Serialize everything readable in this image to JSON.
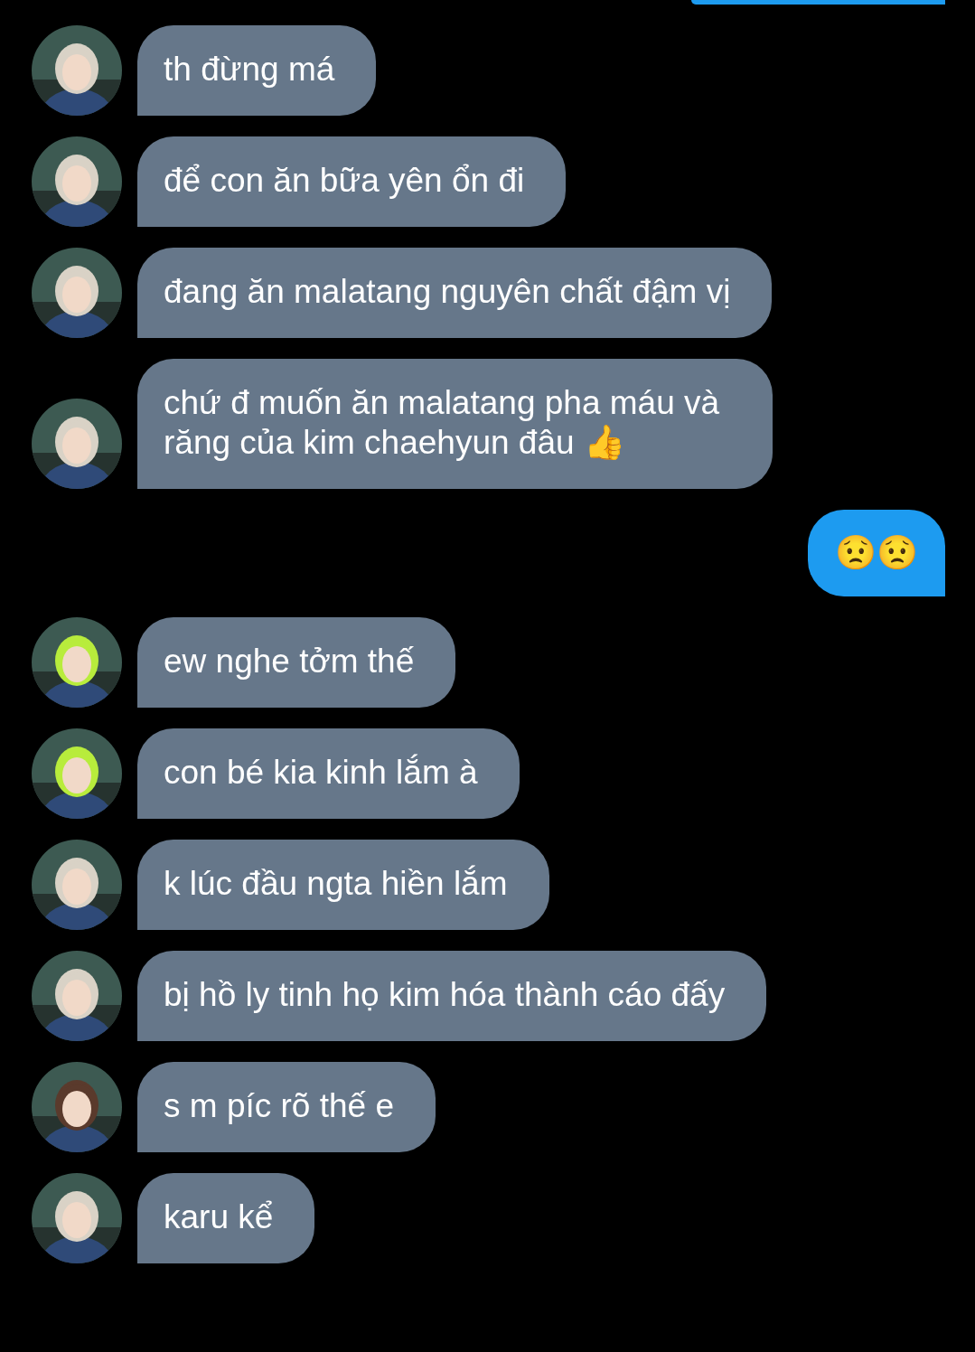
{
  "messages": [
    {
      "kind": "outgoing-edge"
    },
    {
      "kind": "incoming",
      "text": "th đừng má"
    },
    {
      "kind": "incoming",
      "text": "để con ăn bữa yên ổn đi"
    },
    {
      "kind": "incoming",
      "text": "đang ăn malatang nguyên chất đậm vị"
    },
    {
      "kind": "incoming",
      "text": "chứ đ muốn ăn malatang pha máu và răng của kim chaehyun đâu 👍"
    },
    {
      "kind": "outgoing",
      "text": "😟😟"
    },
    {
      "kind": "incoming",
      "text": "ew nghe tởm thế"
    },
    {
      "kind": "incoming",
      "text": "con bé kia kinh lắm à"
    },
    {
      "kind": "incoming",
      "text": "k lúc đầu ngta hiền lắm"
    },
    {
      "kind": "incoming",
      "text": "bị hồ ly tinh họ kim hóa thành cáo đấy"
    },
    {
      "kind": "incoming",
      "text": "s m píc rõ thế e"
    },
    {
      "kind": "incoming",
      "text": "karu kể"
    }
  ]
}
